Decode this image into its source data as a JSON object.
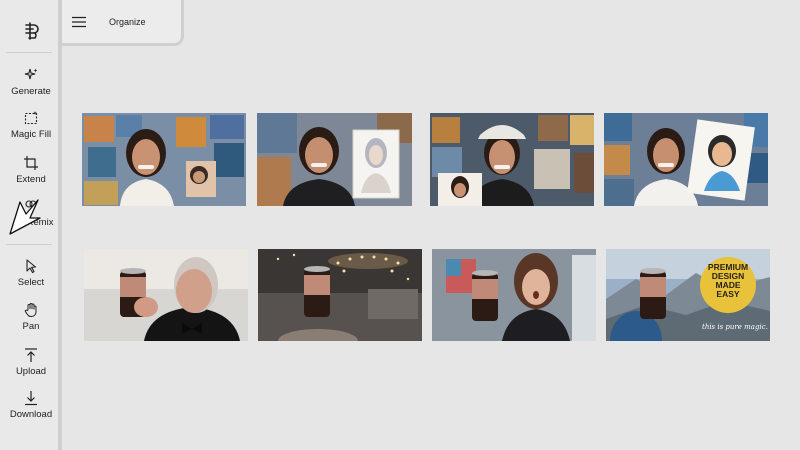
{
  "header": {
    "title": "Organize"
  },
  "sidebar": {
    "tools": [
      {
        "label": "Generate",
        "icon": "sparkle-icon"
      },
      {
        "label": "Magic Fill",
        "icon": "magic-fill-icon"
      },
      {
        "label": "Extend",
        "icon": "crop-extend-icon"
      },
      {
        "label": "Remix",
        "icon": "remix-icon"
      },
      {
        "label": "Select",
        "icon": "pointer-icon"
      },
      {
        "label": "Pan",
        "icon": "hand-icon"
      },
      {
        "label": "Upload",
        "icon": "upload-icon"
      },
      {
        "label": "Download",
        "icon": "download-icon"
      }
    ]
  },
  "gallery": {
    "row1": [
      {
        "desc": "woman-smiling-art-wall"
      },
      {
        "desc": "woman-holding-sketch"
      },
      {
        "desc": "woman-cap-holding-photo"
      },
      {
        "desc": "woman-holding-cartoon-portrait"
      }
    ],
    "row2": [
      {
        "desc": "old-man-tuxedo-can"
      },
      {
        "desc": "can-in-restaurant"
      },
      {
        "desc": "surprised-woman-can"
      },
      {
        "desc": "can-mountain-ad"
      }
    ],
    "ad": {
      "line1": "PREMIUM",
      "line2": "DESIGN",
      "line3": "MADE",
      "line4": "EASY",
      "tagline": "this is pure magic."
    }
  },
  "colors": {
    "background": "#e6e6e6",
    "sidebar": "#e9e9e9",
    "badge": "#e7c23a"
  }
}
